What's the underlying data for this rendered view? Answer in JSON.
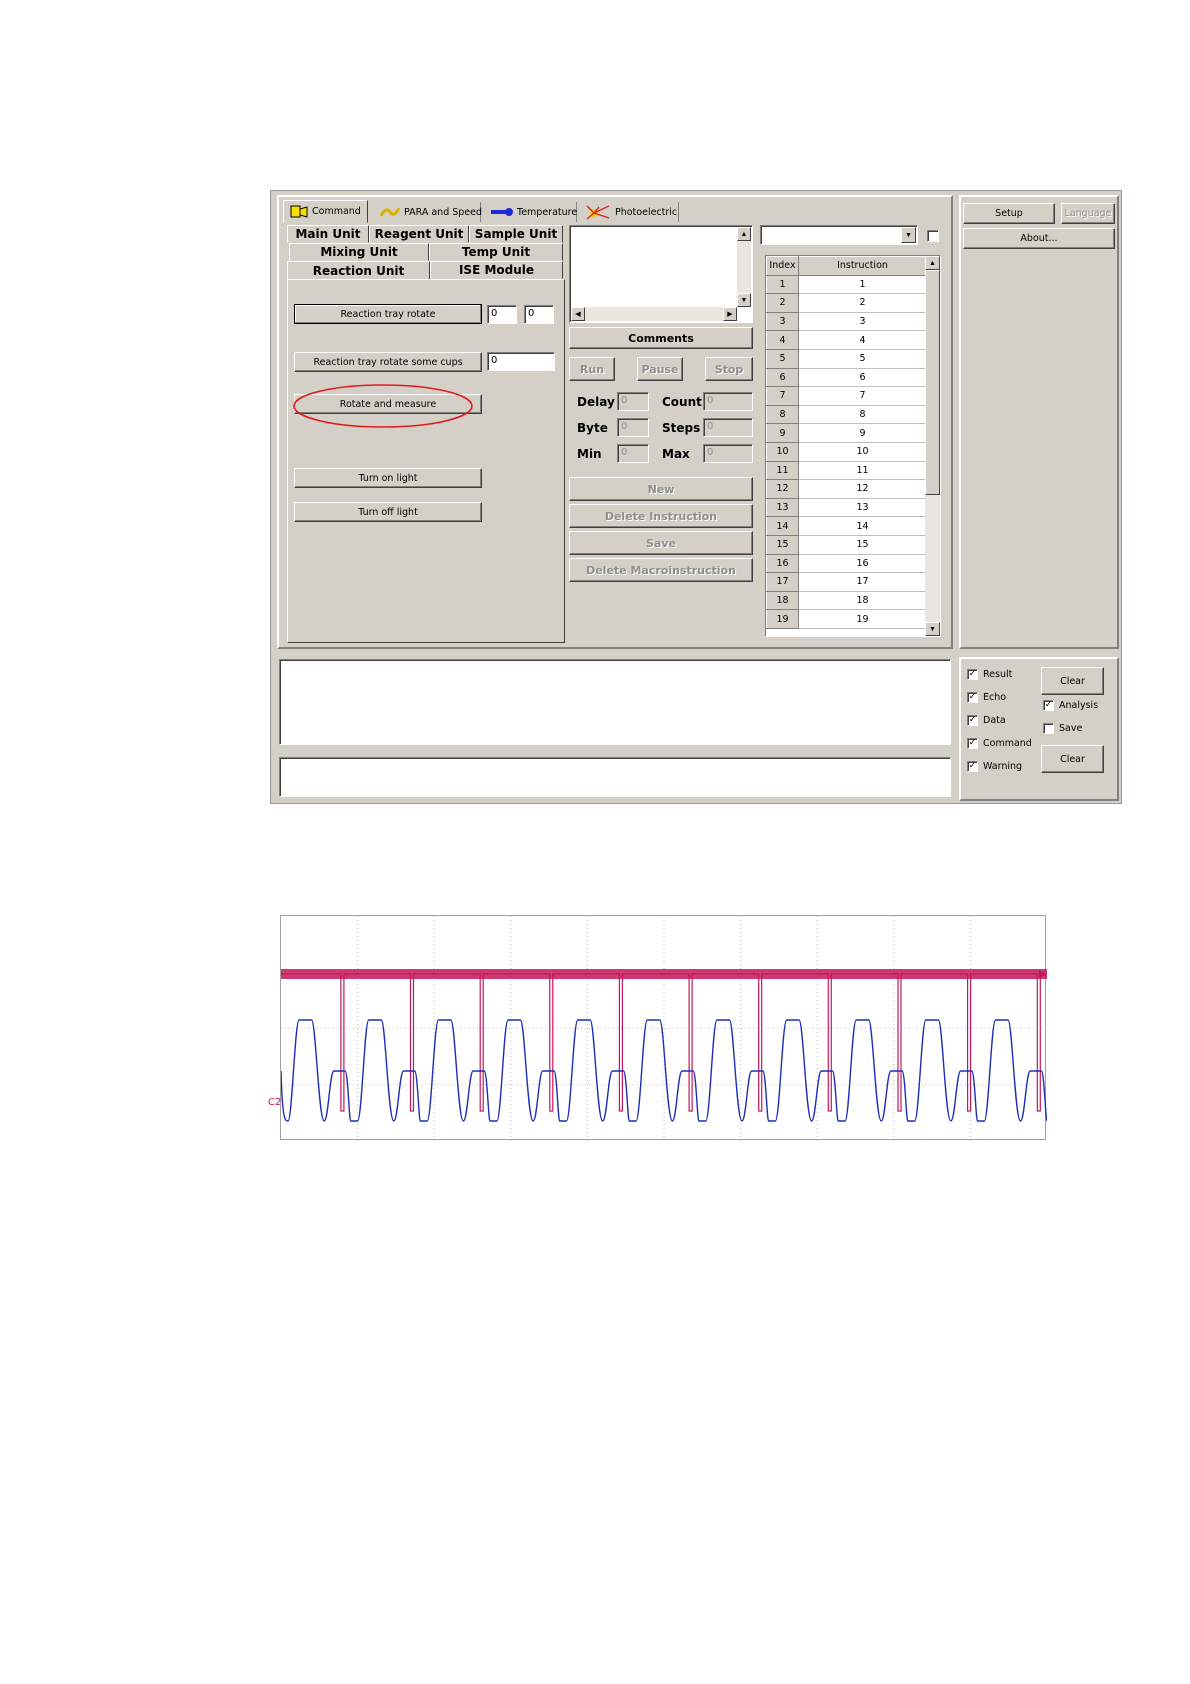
{
  "top_tabs": [
    {
      "label": "Command",
      "icon": "command-icon"
    },
    {
      "label": "PARA and Speed",
      "icon": "para-speed-icon"
    },
    {
      "label": "Temperature",
      "icon": "thermometer-icon"
    },
    {
      "label": "Photoelectric",
      "icon": "photoelectric-icon"
    }
  ],
  "unit_tabs": {
    "main": "Main Unit",
    "reagent": "Reagent Unit",
    "sample": "Sample Unit",
    "mixing": "Mixing Unit",
    "temp": "Temp Unit",
    "reaction": "Reaction Unit",
    "ise": "ISE Module"
  },
  "reaction_panel": {
    "rotate_label": "Reaction tray rotate",
    "rotate_value_1": "0",
    "rotate_value_2": "0",
    "rotate_some_label": "Reaction tray rotate some cups",
    "rotate_some_value": "0",
    "rotate_measure_label": "Rotate and measure",
    "light_on_label": "Turn on light",
    "light_off_label": "Turn off light"
  },
  "macro": {
    "comments_label": "Comments",
    "run": "Run",
    "pause": "Pause",
    "stop": "Stop",
    "delay_label": "Delay",
    "delay_value": "0",
    "count_label": "Count",
    "count_value": "0",
    "byte_label": "Byte",
    "byte_value": "0",
    "steps_label": "Steps",
    "steps_value": "0",
    "min_label": "Min",
    "min_value": "0",
    "max_label": "Max",
    "max_value": "0",
    "new": "New",
    "delete_instruction": "Delete Instruction",
    "save": "Save",
    "delete_macro": "Delete Macroinstruction"
  },
  "instruction_table": {
    "headers": [
      "Index",
      "Instruction"
    ],
    "rows": [
      [
        "1",
        "1"
      ],
      [
        "2",
        "2"
      ],
      [
        "3",
        "3"
      ],
      [
        "4",
        "4"
      ],
      [
        "5",
        "5"
      ],
      [
        "6",
        "6"
      ],
      [
        "7",
        "7"
      ],
      [
        "8",
        "8"
      ],
      [
        "9",
        "9"
      ],
      [
        "10",
        "10"
      ],
      [
        "11",
        "11"
      ],
      [
        "12",
        "12"
      ],
      [
        "13",
        "13"
      ],
      [
        "14",
        "14"
      ],
      [
        "15",
        "15"
      ],
      [
        "16",
        "16"
      ],
      [
        "17",
        "17"
      ],
      [
        "18",
        "18"
      ],
      [
        "19",
        "19"
      ]
    ]
  },
  "right_panel": {
    "setup": "Setup",
    "language": "Language",
    "about": "About..."
  },
  "log_options": {
    "result": "Result",
    "echo": "Echo",
    "data": "Data",
    "command": "Command",
    "warning": "Warning",
    "analysis": "Analysis",
    "save": "Save",
    "clear_top": "Clear",
    "clear_bottom": "Clear"
  },
  "colors": {
    "highlight_ellipse": "#e11a1a",
    "trace_ch1": "#c2185b",
    "trace_ch2": "#1a2fb5"
  },
  "scope": {
    "channel_label": "C2",
    "cycles": 11,
    "chart_data": {
      "type": "line",
      "series": [
        {
          "values": [
            0.8,
            0.8,
            0.8,
            0.05,
            0.8,
            0.8,
            0.8,
            0.05,
            0.8
          ]
        },
        {
          "values": [
            0.0,
            0.9,
            0.9,
            0.3,
            0.0,
            0.45,
            0.45,
            0.0,
            0.9
          ]
        }
      ]
    }
  }
}
